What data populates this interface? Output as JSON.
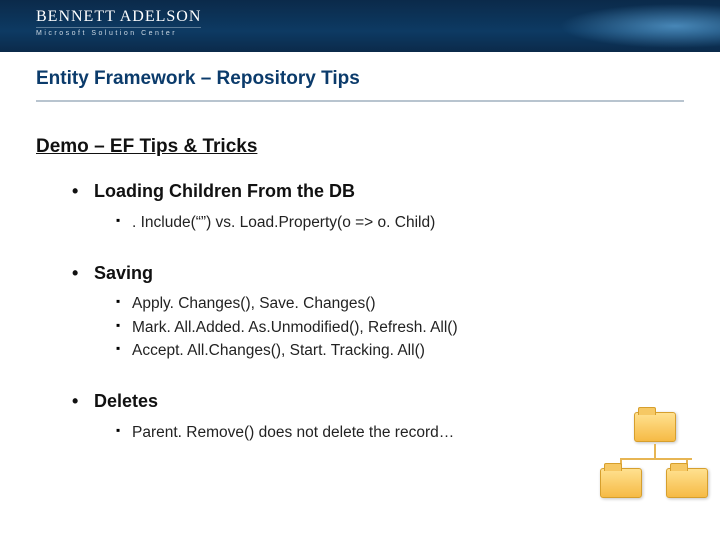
{
  "logo": {
    "main": "BENNETT ADELSON",
    "sub": "Microsoft Solution Center"
  },
  "title": "Entity Framework – Repository Tips",
  "subtitle": "Demo – EF Tips & Tricks",
  "sections": [
    {
      "heading": "Loading Children From the DB",
      "items": [
        ". Include(“”) vs. Load.Property(o => o. Child)"
      ]
    },
    {
      "heading": "Saving",
      "items": [
        "Apply. Changes(), Save. Changes()",
        "Mark. All.Added. As.Unmodified(), Refresh. All()",
        "Accept. All.Changes(), Start. Tracking. All()"
      ]
    },
    {
      "heading": "Deletes",
      "items": [
        "Parent. Remove()  does not delete the record…"
      ]
    }
  ]
}
